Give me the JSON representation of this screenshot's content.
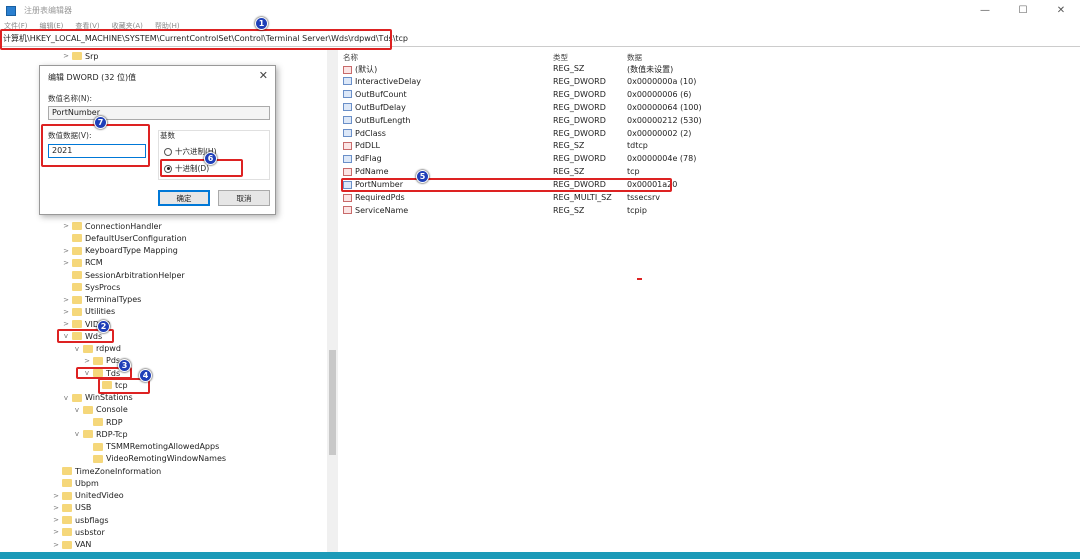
{
  "window": {
    "title": "注册表编辑器",
    "menu": [
      "文件(F)",
      "编辑(E)",
      "查看(V)",
      "收藏夹(A)",
      "帮助(H)"
    ],
    "controls": [
      "—",
      "☐",
      "✕"
    ]
  },
  "address": "计算机\\HKEY_LOCAL_MACHINE\\SYSTEM\\CurrentControlSet\\Control\\Terminal Server\\Wds\\rdpwd\\Tds\\tcp",
  "tree": {
    "top_item": "Srp",
    "items": [
      {
        "label": "ConnectionHandler",
        "level": 1,
        "exp": ">"
      },
      {
        "label": "DefaultUserConfiguration",
        "level": 1,
        "exp": ""
      },
      {
        "label": "KeyboardType Mapping",
        "level": 1,
        "exp": ">"
      },
      {
        "label": "RCM",
        "level": 1,
        "exp": ">"
      },
      {
        "label": "SessionArbitrationHelper",
        "level": 1,
        "exp": ""
      },
      {
        "label": "SysProcs",
        "level": 1,
        "exp": ""
      },
      {
        "label": "TerminalTypes",
        "level": 1,
        "exp": ">"
      },
      {
        "label": "Utilities",
        "level": 1,
        "exp": ">"
      },
      {
        "label": "VIDEO",
        "level": 1,
        "exp": ">"
      },
      {
        "label": "Wds",
        "level": 1,
        "exp": "v"
      },
      {
        "label": "rdpwd",
        "level": 2,
        "exp": "v"
      },
      {
        "label": "Pds",
        "level": 3,
        "exp": ">"
      },
      {
        "label": "Tds",
        "level": 3,
        "exp": "v"
      },
      {
        "label": "tcp",
        "level": 4,
        "exp": ""
      },
      {
        "label": "WinStations",
        "level": 1,
        "exp": "v"
      },
      {
        "label": "Console",
        "level": 2,
        "exp": "v"
      },
      {
        "label": "RDP",
        "level": 3,
        "exp": ""
      },
      {
        "label": "RDP-Tcp",
        "level": 2,
        "exp": "v"
      },
      {
        "label": "TSMMRemotingAllowedApps",
        "level": 3,
        "exp": ""
      },
      {
        "label": "VideoRemotingWindowNames",
        "level": 3,
        "exp": ""
      },
      {
        "label": "TimeZoneInformation",
        "level": 0,
        "exp": ""
      },
      {
        "label": "Ubpm",
        "level": 0,
        "exp": ""
      },
      {
        "label": "UnitedVideo",
        "level": 0,
        "exp": ">"
      },
      {
        "label": "USB",
        "level": 0,
        "exp": ">"
      },
      {
        "label": "usbflags",
        "level": 0,
        "exp": ">"
      },
      {
        "label": "usbstor",
        "level": 0,
        "exp": ">"
      },
      {
        "label": "VAN",
        "level": 0,
        "exp": ">"
      }
    ]
  },
  "list": {
    "headers": {
      "name": "名称",
      "type": "类型",
      "data": "数据"
    },
    "rows": [
      {
        "name": "(默认)",
        "type": "REG_SZ",
        "data": "(数值未设置)",
        "kind": "sz"
      },
      {
        "name": "InteractiveDelay",
        "type": "REG_DWORD",
        "data": "0x0000000a (10)",
        "kind": "dword"
      },
      {
        "name": "OutBufCount",
        "type": "REG_DWORD",
        "data": "0x00000006 (6)",
        "kind": "dword"
      },
      {
        "name": "OutBufDelay",
        "type": "REG_DWORD",
        "data": "0x00000064 (100)",
        "kind": "dword"
      },
      {
        "name": "OutBufLength",
        "type": "REG_DWORD",
        "data": "0x00000212 (530)",
        "kind": "dword"
      },
      {
        "name": "PdClass",
        "type": "REG_DWORD",
        "data": "0x00000002 (2)",
        "kind": "dword"
      },
      {
        "name": "PdDLL",
        "type": "REG_SZ",
        "data": "tdtcp",
        "kind": "sz"
      },
      {
        "name": "PdFlag",
        "type": "REG_DWORD",
        "data": "0x0000004e (78)",
        "kind": "dword"
      },
      {
        "name": "PdName",
        "type": "REG_SZ",
        "data": "tcp",
        "kind": "sz"
      },
      {
        "name": "PortNumber",
        "type": "REG_DWORD",
        "data": "0x00001a20",
        "kind": "dword"
      },
      {
        "name": "RequiredPds",
        "type": "REG_MULTI_SZ",
        "data": "tssecsrv",
        "kind": "sz"
      },
      {
        "name": "ServiceName",
        "type": "REG_SZ",
        "data": "tcpip",
        "kind": "sz"
      }
    ]
  },
  "dialog": {
    "title": "编辑 DWORD (32 位)值",
    "name_label": "数值名称(N):",
    "name_value": "PortNumber",
    "data_label": "数值数据(V):",
    "data_value": "2021",
    "base_label": "基数",
    "hex_label": "十六进制(H)",
    "dec_label": "十进制(D)",
    "base_selected": "decimal",
    "ok": "确定",
    "cancel": "取消"
  },
  "annotations": [
    "1",
    "2",
    "3",
    "4",
    "5",
    "6",
    "7"
  ],
  "colors": {
    "highlight": "#dd2222",
    "badge": "#1f3fb8",
    "taskbar": "#1b9ab8"
  }
}
